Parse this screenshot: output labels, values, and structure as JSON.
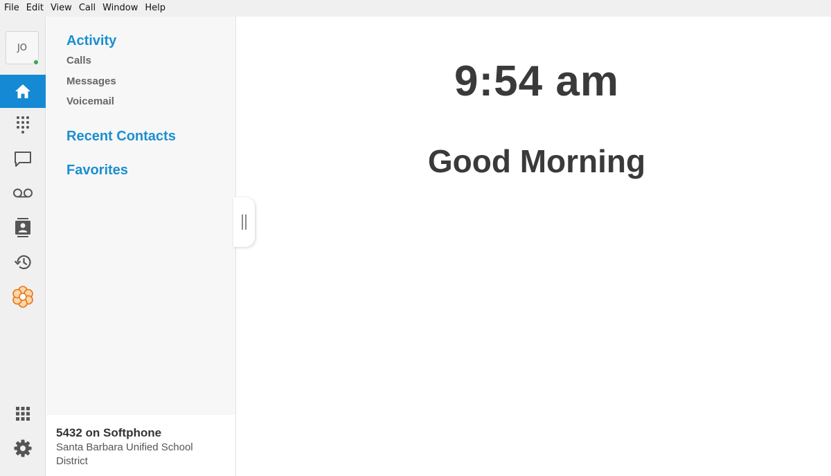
{
  "menubar": {
    "items": [
      "File",
      "Edit",
      "View",
      "Call",
      "Window",
      "Help"
    ]
  },
  "rail": {
    "avatar_initials": "JO",
    "presence": "online",
    "buttons": [
      {
        "icon": "home-icon",
        "active": true
      },
      {
        "icon": "dialpad-icon",
        "active": false
      },
      {
        "icon": "chat-icon",
        "active": false
      },
      {
        "icon": "voicemail-icon",
        "active": false
      },
      {
        "icon": "contacts-icon",
        "active": false
      },
      {
        "icon": "history-icon",
        "active": false
      },
      {
        "icon": "meetings-flower-icon",
        "active": false
      },
      {
        "icon": "apps-grid-icon",
        "active": false
      },
      {
        "icon": "gear-icon",
        "active": false
      }
    ]
  },
  "nav": {
    "activity": "Activity",
    "calls": "Calls",
    "messages": "Messages",
    "voicemail": "Voicemail",
    "recent_contacts": "Recent Contacts",
    "favorites": "Favorites"
  },
  "status": {
    "line": "5432 on Softphone",
    "organization": "Santa Barbara Unified School District"
  },
  "main": {
    "time": "9:54 am",
    "greeting": "Good Morning"
  },
  "colors": {
    "accent": "#1589d3",
    "link": "#1a8fd0",
    "presence": "#3fa34d",
    "meetings_icon": "#f08a24"
  }
}
